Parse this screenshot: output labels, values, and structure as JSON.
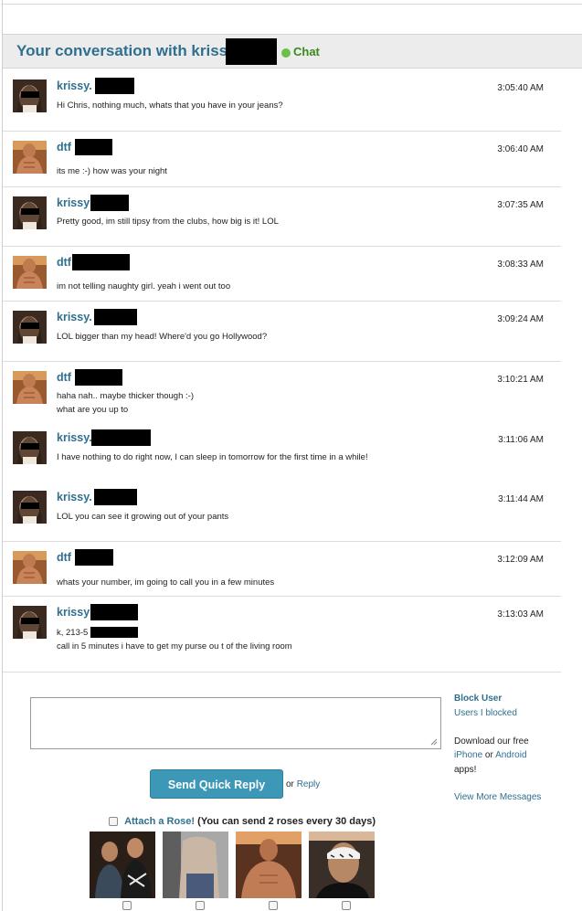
{
  "header": {
    "title": "Your conversation with krissy.",
    "chat_label": "Chat",
    "colors": {
      "title": "#2f6f8f",
      "online": "#6cc04a",
      "header_bg": "#ececec"
    }
  },
  "messages": [
    {
      "sender": "krissy.",
      "time": "3:05:40 AM",
      "lines": [
        "Hi Chris, nothing much, whats that you have in your jeans?"
      ]
    },
    {
      "sender": "dtf",
      "time": "3:06:40 AM",
      "lines": [
        "its me :-) how was your night"
      ]
    },
    {
      "sender": "krissy",
      "time": "3:07:35 AM",
      "lines": [
        "Pretty good, im still tipsy from the clubs, how big is it! LOL"
      ]
    },
    {
      "sender": "dtf",
      "time": "3:08:33 AM",
      "lines": [
        "im not telling naughty girl. yeah i went out too"
      ]
    },
    {
      "sender": "krissy.",
      "time": "3:09:24 AM",
      "lines": [
        "LOL bigger than my head! Where'd you go Hollywood?"
      ]
    },
    {
      "sender": "dtf",
      "time": "3:10:21 AM",
      "lines": [
        "haha nah.. maybe thicker though :-)",
        "what are you up to"
      ]
    },
    {
      "sender": "krissy.",
      "time": "3:11:06 AM",
      "lines": [
        "I have nothing to do right now, I can sleep in tomorrow for the first time in a while!"
      ]
    },
    {
      "sender": "krissy.",
      "time": "3:11:44 AM",
      "lines": [
        "LOL you can see it growing out of your pants"
      ]
    },
    {
      "sender": "dtf",
      "time": "3:12:09 AM",
      "lines": [
        "whats your number, im going to call you in a few minutes"
      ]
    },
    {
      "sender": "krissy",
      "time": "3:13:03 AM",
      "lines": [
        "k, 213-5",
        "call in 5 minutes i have to get my purse ou t of the living room"
      ]
    }
  ],
  "sidebar": {
    "block_user": "Block User",
    "users_blocked": "Users I blocked",
    "download_prefix": "Download our free",
    "iphone": "iPhone",
    "or": "or",
    "android": "Android",
    "apps": "apps!",
    "view_more": "View More Messages"
  },
  "reply": {
    "textarea_value": "",
    "send_label": "Send Quick Reply",
    "or_text": "or",
    "reply_link": "Reply"
  },
  "rose": {
    "link": "Attach a Rose!",
    "note": "(You can send 2 roses every 30 days)"
  },
  "photos": [
    {
      "icon": "photo-two-men"
    },
    {
      "icon": "photo-torso"
    },
    {
      "icon": "photo-shirtless"
    },
    {
      "icon": "photo-bandana"
    }
  ]
}
